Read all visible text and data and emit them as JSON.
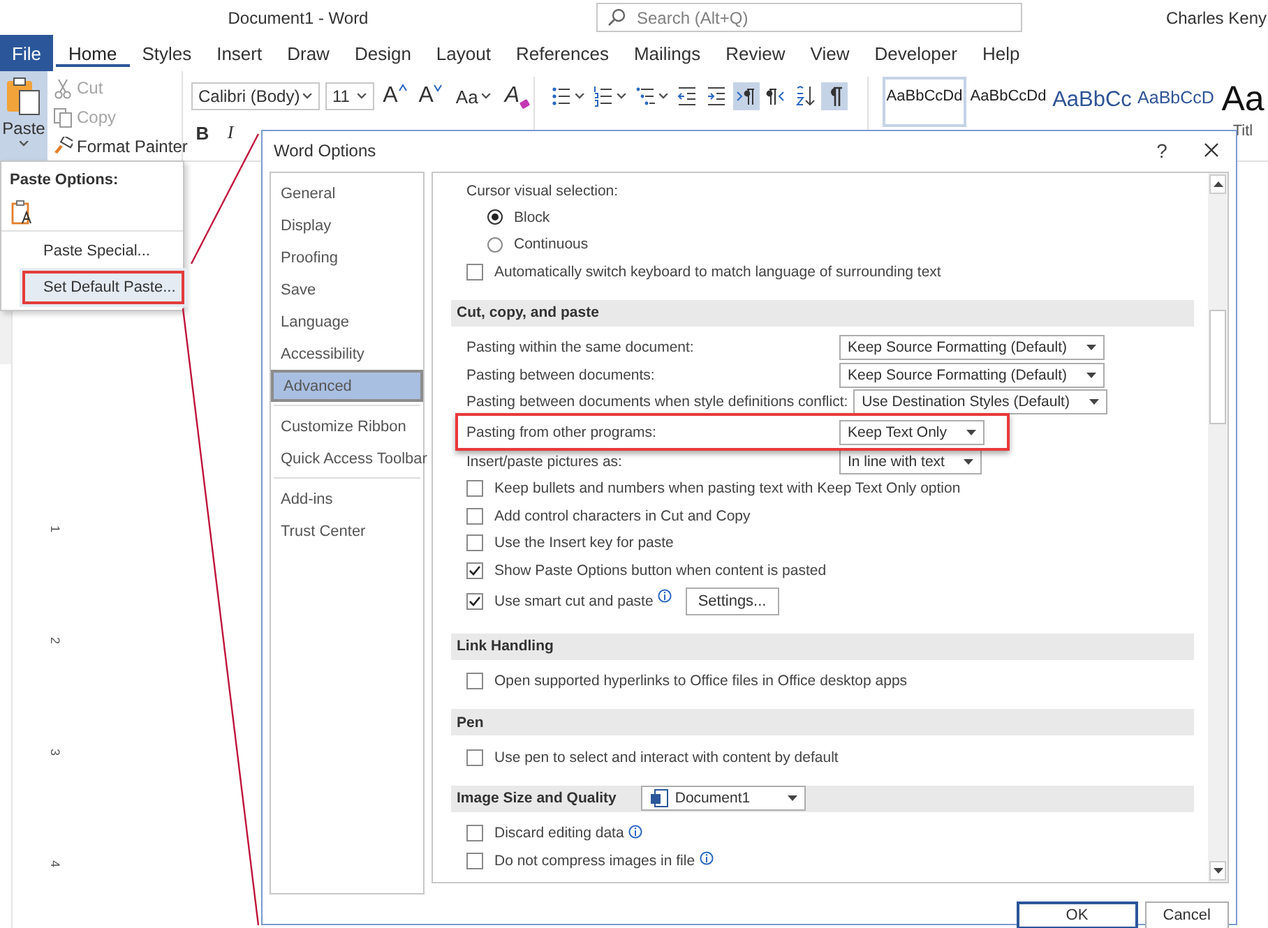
{
  "title_bar": {
    "title": "Document1 - Word",
    "search": {
      "placeholder": "Search (Alt+Q)"
    },
    "user": "Charles Keny"
  },
  "ribbon_tabs": [
    {
      "label": "File",
      "kind": "file",
      "selected": false
    },
    {
      "label": "Home",
      "kind": "tab",
      "selected": true
    },
    {
      "label": "Styles",
      "kind": "tab",
      "selected": false
    },
    {
      "label": "Insert",
      "kind": "tab",
      "selected": false
    },
    {
      "label": "Draw",
      "kind": "tab",
      "selected": false
    },
    {
      "label": "Design",
      "kind": "tab",
      "selected": false
    },
    {
      "label": "Layout",
      "kind": "tab",
      "selected": false
    },
    {
      "label": "References",
      "kind": "tab",
      "selected": false
    },
    {
      "label": "Mailings",
      "kind": "tab",
      "selected": false
    },
    {
      "label": "Review",
      "kind": "tab",
      "selected": false
    },
    {
      "label": "View",
      "kind": "tab",
      "selected": false
    },
    {
      "label": "Developer",
      "kind": "tab",
      "selected": false
    },
    {
      "label": "Help",
      "kind": "tab",
      "selected": false
    }
  ],
  "clipboard": {
    "paste": {
      "label": "Paste",
      "expanded": true
    },
    "items": [
      {
        "label": "Cut",
        "kind": "cut",
        "disabled": true
      },
      {
        "label": "Copy",
        "kind": "copy",
        "disabled": true
      },
      {
        "label": "Format Painter",
        "kind": "painter",
        "disabled": false
      }
    ]
  },
  "font": {
    "name": "Calibri (Body)",
    "size": "11",
    "size_buttons": [
      {
        "label": "A",
        "kind": "grow"
      },
      {
        "label": "A",
        "kind": "shrink"
      }
    ],
    "change_case": "Aa",
    "clear_formatting": "A",
    "format_buttons": [
      {
        "label": "B",
        "kind": "bold"
      },
      {
        "label": "I",
        "kind": "italic"
      }
    ]
  },
  "paragraph_buttons": [
    {
      "kind": "bullets",
      "selected": false
    },
    {
      "kind": "numbering",
      "selected": false
    },
    {
      "kind": "multilevel",
      "selected": false
    },
    {
      "kind": "decrease_indent",
      "selected": false
    },
    {
      "kind": "increase_indent",
      "selected": false
    },
    {
      "kind": "ltr",
      "selected": true
    },
    {
      "kind": "rtl",
      "selected": false
    },
    {
      "kind": "sort",
      "selected": false
    },
    {
      "kind": "show_marks",
      "selected": true
    }
  ],
  "styles": [
    {
      "sample": "AaBbCcDd",
      "kind": "normal",
      "selected": true
    },
    {
      "sample": "AaBbCcDd",
      "kind": "no_spacing",
      "selected": false
    },
    {
      "sample": "AaBbCc",
      "kind": "heading1",
      "selected": false
    },
    {
      "sample": "AaBbCcD",
      "kind": "heading2",
      "selected": false
    },
    {
      "sample": "Aa",
      "kind": "title",
      "selected": false,
      "caption": "Titl"
    }
  ],
  "paste_menu": {
    "heading": "Paste Options:",
    "items": [
      {
        "label": "Paste Special...",
        "selected": false
      },
      {
        "label": "Set Default Paste...",
        "selected": true
      }
    ]
  },
  "ruler": {
    "numbers": [
      "1",
      "2",
      "3",
      "4"
    ]
  },
  "dialog": {
    "title": "Word Options",
    "help": "?",
    "nav_groups": [
      [
        {
          "label": "General",
          "selected": false
        },
        {
          "label": "Display",
          "selected": false
        },
        {
          "label": "Proofing",
          "selected": false
        },
        {
          "label": "Save",
          "selected": false
        },
        {
          "label": "Language",
          "selected": false
        },
        {
          "label": "Accessibility",
          "selected": false
        },
        {
          "label": "Advanced",
          "selected": true
        }
      ],
      [
        {
          "label": "Customize Ribbon",
          "selected": false
        },
        {
          "label": "Quick Access Toolbar",
          "selected": false
        }
      ],
      [
        {
          "label": "Add-ins",
          "selected": false
        },
        {
          "label": "Trust Center",
          "selected": false
        }
      ]
    ],
    "content": [
      {
        "kind": "label",
        "text": "Cursor visual selection:"
      },
      {
        "kind": "radio",
        "label": "Block",
        "selected": true
      },
      {
        "kind": "radio",
        "label": "Continuous",
        "selected": false
      },
      {
        "kind": "checkbox",
        "label": "Automatically switch keyboard to match language of surrounding text",
        "checked": false
      },
      {
        "kind": "header",
        "text": "Cut, copy, and paste"
      },
      {
        "kind": "dropdown",
        "label": "Pasting within the same document:",
        "value": "Keep Source Formatting (Default)",
        "highlighted": false
      },
      {
        "kind": "dropdown",
        "label": "Pasting between documents:",
        "value": "Keep Source Formatting (Default)",
        "highlighted": false
      },
      {
        "kind": "dropdown",
        "label": "Pasting between documents when style definitions conflict:",
        "value": "Use Destination Styles (Default)",
        "highlighted": false
      },
      {
        "kind": "dropdown",
        "label": "Pasting from other programs:",
        "value": "Keep Text Only",
        "highlighted": true
      },
      {
        "kind": "dropdown",
        "label": "Insert/paste pictures as:",
        "value": "In line with text",
        "highlighted": false
      },
      {
        "kind": "checkbox",
        "label": "Keep bullets and numbers when pasting text with Keep Text Only option",
        "checked": false
      },
      {
        "kind": "checkbox",
        "label": "Add control characters in Cut and Copy",
        "checked": false
      },
      {
        "kind": "checkbox",
        "label": "Use the Insert key for paste",
        "checked": false
      },
      {
        "kind": "checkbox",
        "label": "Show Paste Options button when content is pasted",
        "checked": true
      },
      {
        "kind": "checkbox",
        "label": "Use smart cut and paste",
        "checked": true,
        "info": true,
        "button": "Settings..."
      },
      {
        "kind": "header",
        "text": "Link Handling"
      },
      {
        "kind": "checkbox",
        "label": "Open supported hyperlinks to Office files in Office desktop apps",
        "checked": false
      },
      {
        "kind": "header",
        "text": "Pen"
      },
      {
        "kind": "checkbox",
        "label": "Use pen to select and interact with content by default",
        "checked": false
      },
      {
        "kind": "header",
        "text": "Image Size and Quality",
        "value": "Document1"
      },
      {
        "kind": "checkbox",
        "label": "Discard editing data",
        "checked": false,
        "info": true
      },
      {
        "kind": "checkbox",
        "label": "Do not compress images in file",
        "checked": false,
        "info": true
      }
    ],
    "buttons": [
      {
        "label": "OK",
        "kind": "default"
      },
      {
        "label": "Cancel",
        "kind": "normal"
      }
    ]
  }
}
